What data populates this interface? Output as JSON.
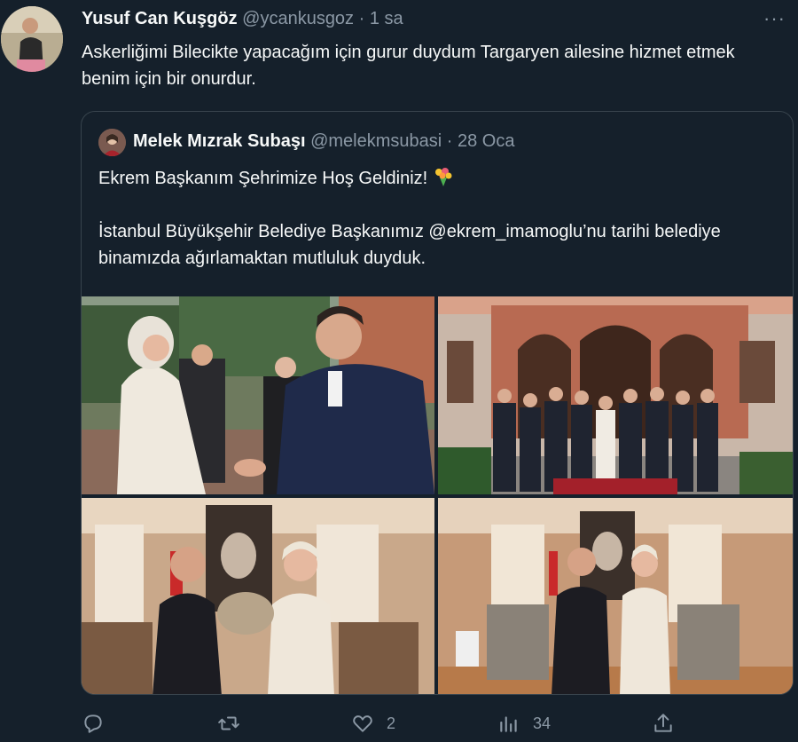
{
  "tweet": {
    "author_name": "Yusuf Can Kuşgöz",
    "handle_time": "@ycankusgoz · 1 sa",
    "text": "Askerliğimi Bilecikte yapacağım için gurur duydum Targaryen ailesine hizmet etmek benim için bir onurdur.",
    "more_label": "···"
  },
  "quote": {
    "author_name": "Melek Mızrak Subaşı",
    "handle_time": "@melekmsubasi · 28 Oca",
    "line1": "Ekrem Başkanım Şehrimize Hoş Geldiniz!",
    "line2": "İstanbul Büyükşehir Belediye Başkanımız @ekrem_imamoglu’nu tarihi belediye binamızda ağırlamaktan mutluluk duyduk."
  },
  "actions": {
    "reply_count": "",
    "retweet_count": "",
    "like_count": "2",
    "views_count": "34"
  },
  "icons": [
    "more-icon",
    "reply-icon",
    "retweet-icon",
    "like-icon",
    "views-icon",
    "share-icon",
    "bouquet-emoji-icon"
  ],
  "colors": {
    "background": "#15202b",
    "text": "#f7f9f9",
    "secondary": "#8b98a5",
    "border": "#38444d"
  }
}
